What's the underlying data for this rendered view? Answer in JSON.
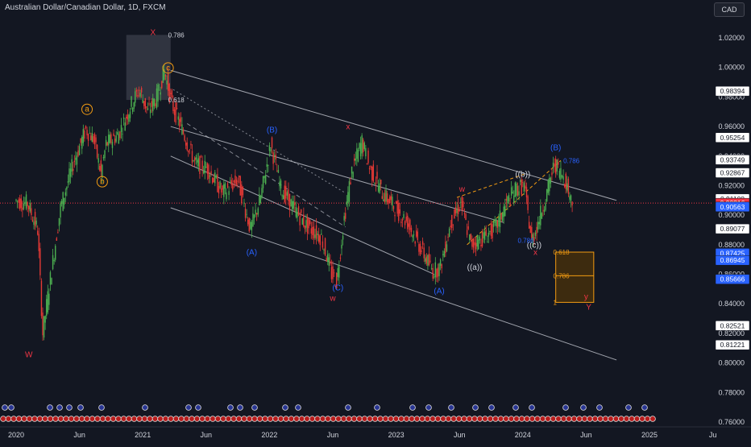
{
  "header": {
    "symbol_title": "Australian Dollar/Canadian Dollar, 1D, FXCM",
    "currency": "CAD"
  },
  "colors": {
    "background": "#131722",
    "up": "#26a69a",
    "down": "#ef5350",
    "candle_green": "#4caf50",
    "candle_red": "#e53935",
    "orange_labels": "#f39c12",
    "blue_labels": "#2962ff",
    "red_labels": "#f23645",
    "current_price_bg": "#f23645",
    "line_white": "#d1d4dc"
  },
  "chart_data": {
    "type": "candlestick",
    "title": "Australian Dollar/Canadian Dollar, 1D, FXCM",
    "x_tick_labels": [
      "2020",
      "Jun",
      "2021",
      "Jun",
      "2022",
      "Jun",
      "2023",
      "Jun",
      "2024",
      "Jun",
      "2025",
      "Ju"
    ],
    "y_tick_labels": [
      "1.02000",
      "1.00000",
      "0.98000",
      "0.96000",
      "0.94000",
      "0.92000",
      "0.90000",
      "0.88000",
      "0.86000",
      "0.84000",
      "0.82000",
      "0.80000",
      "0.78000",
      "0.76000"
    ],
    "ylim": [
      0.755,
      1.03
    ],
    "price_tags": [
      {
        "value": "0.98394",
        "style": "white"
      },
      {
        "value": "0.95254",
        "style": "white"
      },
      {
        "value": "0.93749",
        "style": "white"
      },
      {
        "value": "0.92867",
        "style": "white"
      },
      {
        "value": "0.91108",
        "style": "white"
      },
      {
        "value": "0.90816",
        "style": "red"
      },
      {
        "value": "0.90563",
        "style": "blue"
      },
      {
        "value": "0.89077",
        "style": "white"
      },
      {
        "value": "0.87425",
        "style": "blue"
      },
      {
        "value": "0.86945",
        "style": "blue"
      },
      {
        "value": "0.85666",
        "style": "blue"
      },
      {
        "value": "0.82521",
        "style": "white"
      },
      {
        "value": "0.81221",
        "style": "white"
      }
    ],
    "wave_labels": [
      {
        "text": "W",
        "t": 0.1,
        "p": 0.804,
        "color": "red"
      },
      {
        "text": "a",
        "t": 0.56,
        "p": 0.97,
        "color": "orange",
        "circled": true
      },
      {
        "text": "b",
        "t": 0.68,
        "p": 0.921,
        "color": "orange",
        "circled": true
      },
      {
        "text": "X",
        "t": 1.08,
        "p": 1.022,
        "color": "red"
      },
      {
        "text": "c",
        "t": 1.2,
        "p": 0.998,
        "color": "orange",
        "circled": true
      },
      {
        "text": "(B)",
        "t": 2.02,
        "p": 0.956,
        "color": "blue"
      },
      {
        "text": "(A)",
        "t": 1.86,
        "p": 0.873,
        "color": "blue"
      },
      {
        "text": "x",
        "t": 2.62,
        "p": 0.958,
        "color": "red"
      },
      {
        "text": "(C)",
        "t": 2.54,
        "p": 0.849,
        "color": "blue"
      },
      {
        "text": "w",
        "t": 2.5,
        "p": 0.842,
        "color": "red"
      },
      {
        "text": "(A)",
        "t": 3.34,
        "p": 0.847,
        "color": "blue"
      },
      {
        "text": "w",
        "t": 3.52,
        "p": 0.916,
        "color": "red"
      },
      {
        "text": "((a))",
        "t": 3.62,
        "p": 0.863,
        "color": "white"
      },
      {
        "text": "((b))",
        "t": 4.0,
        "p": 0.926,
        "color": "white"
      },
      {
        "text": "((c))",
        "t": 4.09,
        "p": 0.878,
        "color": "white"
      },
      {
        "text": "x",
        "t": 4.1,
        "p": 0.873,
        "color": "red"
      },
      {
        "text": "(B)",
        "t": 4.26,
        "p": 0.944,
        "color": "blue"
      },
      {
        "text": "y",
        "t": 4.5,
        "p": 0.843,
        "color": "red"
      },
      {
        "text": "Y",
        "t": 4.52,
        "p": 0.836,
        "color": "red"
      }
    ],
    "fib_labels": [
      {
        "text": "0.786",
        "t": 1.2,
        "p": 1.022,
        "color": "white"
      },
      {
        "text": "0.618",
        "t": 1.2,
        "p": 0.978,
        "color": "white"
      },
      {
        "text": "0.786",
        "t": 4.32,
        "p": 0.937,
        "color": "blue"
      },
      {
        "text": "0.786",
        "t": 3.96,
        "p": 0.883,
        "color": "blue"
      },
      {
        "text": "0.618",
        "t": 4.24,
        "p": 0.875,
        "color": "orange"
      },
      {
        "text": "0.786",
        "t": 4.24,
        "p": 0.859,
        "color": "orange"
      },
      {
        "text": "1",
        "t": 4.24,
        "p": 0.841,
        "color": "orange"
      }
    ],
    "price_path": [
      {
        "t": 0.0,
        "p": 0.91
      },
      {
        "t": 0.1,
        "p": 0.908
      },
      {
        "t": 0.18,
        "p": 0.89
      },
      {
        "t": 0.22,
        "p": 0.82
      },
      {
        "t": 0.26,
        "p": 0.845
      },
      {
        "t": 0.36,
        "p": 0.905
      },
      {
        "t": 0.46,
        "p": 0.935
      },
      {
        "t": 0.56,
        "p": 0.958
      },
      {
        "t": 0.62,
        "p": 0.952
      },
      {
        "t": 0.68,
        "p": 0.928
      },
      {
        "t": 0.72,
        "p": 0.948
      },
      {
        "t": 0.82,
        "p": 0.955
      },
      {
        "t": 0.92,
        "p": 0.975
      },
      {
        "t": 0.98,
        "p": 0.985
      },
      {
        "t": 1.05,
        "p": 0.97
      },
      {
        "t": 1.12,
        "p": 0.98
      },
      {
        "t": 1.18,
        "p": 0.998
      },
      {
        "t": 1.24,
        "p": 0.975
      },
      {
        "t": 1.32,
        "p": 0.958
      },
      {
        "t": 1.42,
        "p": 0.935
      },
      {
        "t": 1.52,
        "p": 0.932
      },
      {
        "t": 1.64,
        "p": 0.915
      },
      {
        "t": 1.76,
        "p": 0.924
      },
      {
        "t": 1.86,
        "p": 0.89
      },
      {
        "t": 1.94,
        "p": 0.912
      },
      {
        "t": 2.02,
        "p": 0.948
      },
      {
        "t": 2.1,
        "p": 0.918
      },
      {
        "t": 2.2,
        "p": 0.905
      },
      {
        "t": 2.3,
        "p": 0.893
      },
      {
        "t": 2.42,
        "p": 0.885
      },
      {
        "t": 2.5,
        "p": 0.86
      },
      {
        "t": 2.54,
        "p": 0.855
      },
      {
        "t": 2.6,
        "p": 0.898
      },
      {
        "t": 2.66,
        "p": 0.93
      },
      {
        "t": 2.74,
        "p": 0.95
      },
      {
        "t": 2.8,
        "p": 0.932
      },
      {
        "t": 2.9,
        "p": 0.915
      },
      {
        "t": 3.0,
        "p": 0.905
      },
      {
        "t": 3.1,
        "p": 0.895
      },
      {
        "t": 3.2,
        "p": 0.878
      },
      {
        "t": 3.3,
        "p": 0.862
      },
      {
        "t": 3.36,
        "p": 0.865
      },
      {
        "t": 3.44,
        "p": 0.895
      },
      {
        "t": 3.52,
        "p": 0.908
      },
      {
        "t": 3.6,
        "p": 0.88
      },
      {
        "t": 3.7,
        "p": 0.885
      },
      {
        "t": 3.8,
        "p": 0.892
      },
      {
        "t": 3.88,
        "p": 0.908
      },
      {
        "t": 3.96,
        "p": 0.918
      },
      {
        "t": 4.02,
        "p": 0.92
      },
      {
        "t": 4.08,
        "p": 0.882
      },
      {
        "t": 4.14,
        "p": 0.898
      },
      {
        "t": 4.2,
        "p": 0.915
      },
      {
        "t": 4.26,
        "p": 0.935
      },
      {
        "t": 4.34,
        "p": 0.925
      },
      {
        "t": 4.4,
        "p": 0.908
      }
    ],
    "current_price": 0.90816,
    "grid": false,
    "legend": "none"
  }
}
